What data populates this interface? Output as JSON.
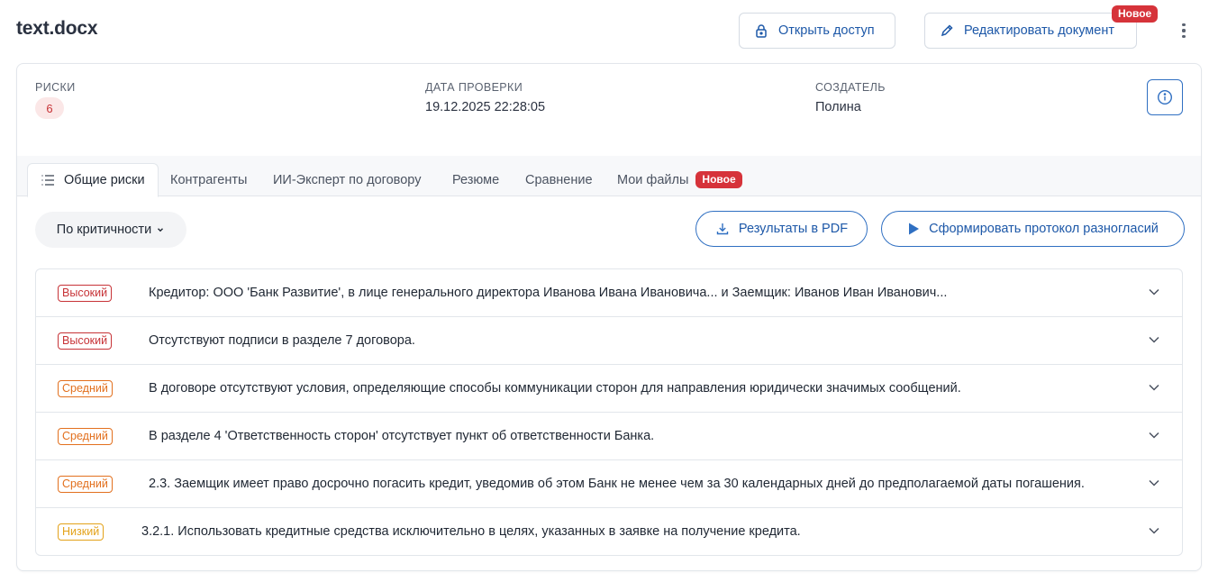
{
  "header": {
    "title": "text.docx",
    "share_label": "Открыть доступ",
    "edit_label": "Редактировать документ",
    "edit_badge": "Новое"
  },
  "meta": {
    "risks_label": "РИСКИ",
    "risks_count": "6",
    "date_label": "ДАТА ПРОВЕРКИ",
    "date_value": "19.12.2025 22:28:05",
    "creator_label": "СОЗДАТЕЛЬ",
    "creator_value": "Полина"
  },
  "tabs": [
    {
      "label": "Общие риски"
    },
    {
      "label": "Контрагенты"
    },
    {
      "label": "ИИ-Эксперт по договору"
    },
    {
      "label": "Резюме"
    },
    {
      "label": "Сравнение"
    },
    {
      "label": "Мои файлы",
      "badge": "Новое"
    }
  ],
  "toolbar": {
    "sort_label": "По критичности",
    "pdf_label": "Результаты в PDF",
    "protocol_label": "Сформировать протокол разногласий"
  },
  "risks": [
    {
      "severity": "Высокий",
      "level": "high",
      "text": "Кредитор: ООО 'Банк Развитие', в лице генерального директора Иванова Ивана Ивановича... и Заемщик: Иванов Иван Иванович..."
    },
    {
      "severity": "Высокий",
      "level": "high",
      "text": "Отсутствуют подписи в разделе 7 договора."
    },
    {
      "severity": "Средний",
      "level": "mid",
      "text": "В договоре отсутствуют условия, определяющие способы коммуникации сторон для направления юридически значимых сообщений."
    },
    {
      "severity": "Средний",
      "level": "mid",
      "text": "В разделе 4 'Ответственность сторон' отсутствует пункт об ответственности Банка."
    },
    {
      "severity": "Средний",
      "level": "mid",
      "text": "2.3. Заемщик имеет право досрочно погасить кредит, уведомив об этом Банк не менее чем за 30 календарных дней до предполагаемой даты погашения."
    },
    {
      "severity": "Низкий",
      "level": "low",
      "text": "3.2.1. Использовать кредитные средства исключительно в целях, указанных в заявке на получение кредита."
    }
  ],
  "colors": {
    "accent": "#1d58a8",
    "high": "#c73337",
    "mid": "#e2701e",
    "low": "#e3a21a",
    "badge": "#d6333a"
  }
}
